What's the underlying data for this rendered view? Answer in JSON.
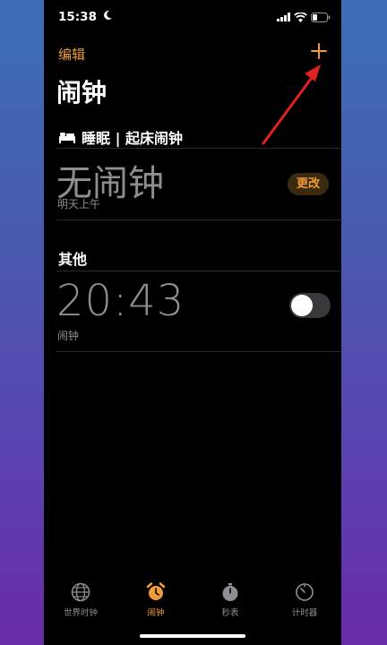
{
  "status": {
    "time": "15:38"
  },
  "nav": {
    "edit_label": "编辑",
    "title": "闹钟"
  },
  "sleep": {
    "header": "睡眠 | 起床闹钟",
    "no_alarm": "无闹钟",
    "subtitle": "明天上午",
    "change_label": "更改"
  },
  "other": {
    "header": "其他",
    "alarms": [
      {
        "time": "20:43",
        "label": "闹钟",
        "enabled": false
      }
    ]
  },
  "tabs": [
    {
      "label": "世界时钟",
      "icon": "globe-icon",
      "active": false
    },
    {
      "label": "闹钟",
      "icon": "alarm-clock-icon",
      "active": true
    },
    {
      "label": "秒表",
      "icon": "stopwatch-icon",
      "active": false
    },
    {
      "label": "计时器",
      "icon": "timer-icon",
      "active": false
    }
  ],
  "colors": {
    "accent": "#f19a38",
    "secondary_text": "#8e8e93",
    "annotation_arrow": "#e0221f"
  }
}
